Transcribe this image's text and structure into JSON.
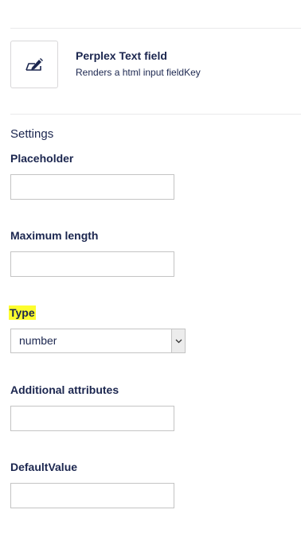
{
  "field_type": {
    "name": "Perplex Text field",
    "description": "Renders a html input fieldKey",
    "icon": "edit-field-icon"
  },
  "settings": {
    "heading": "Settings",
    "placeholder": {
      "label": "Placeholder",
      "value": ""
    },
    "maximum_length": {
      "label": "Maximum length",
      "value": ""
    },
    "type": {
      "label": "Type",
      "selected": "number",
      "highlight_color": "#fdfd2e"
    },
    "additional_attributes": {
      "label": "Additional attributes",
      "value": ""
    },
    "default_value": {
      "label": "DefaultValue",
      "value": ""
    }
  },
  "colors": {
    "text": "#1b264f",
    "border": "#c4c4c4",
    "divider": "#e9e9eb"
  }
}
